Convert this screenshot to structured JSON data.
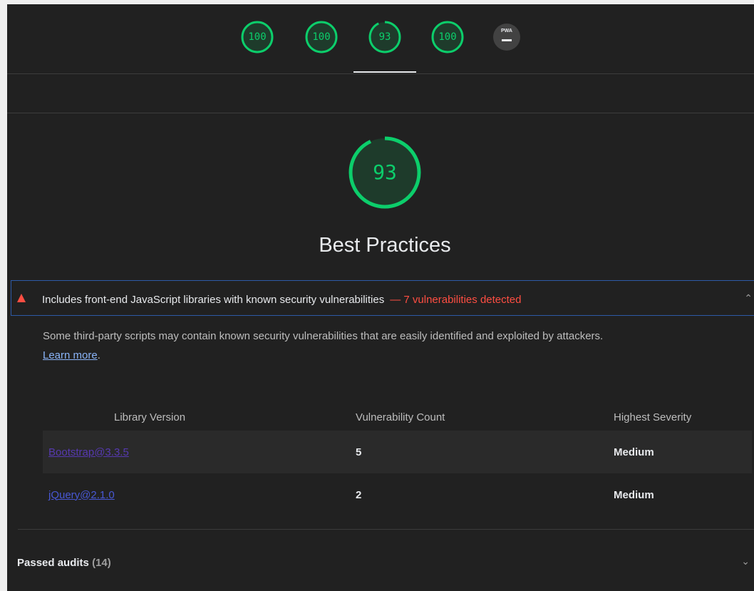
{
  "gauges": [
    {
      "score": "100",
      "value": 100
    },
    {
      "score": "100",
      "value": 100
    },
    {
      "score": "93",
      "value": 93
    },
    {
      "score": "100",
      "value": 100
    }
  ],
  "pwa": {
    "label": "PWA"
  },
  "category": {
    "score": "93",
    "value": 93,
    "title": "Best Practices"
  },
  "audit": {
    "title": "Includes front-end JavaScript libraries with known security vulnerabilities",
    "display_value": "— 7 vulnerabilities detected",
    "description": "Some third-party scripts may contain known security vulnerabilities that are easily identified and exploited by attackers.",
    "learn_more": "Learn more",
    "learn_more_suffix": ".",
    "table": {
      "headers": [
        "Library Version",
        "Vulnerability Count",
        "Highest Severity"
      ],
      "rows": [
        {
          "library": "Bootstrap@3.3.5",
          "count": "5",
          "severity": "Medium"
        },
        {
          "library": "jQuery@2.1.0",
          "count": "2",
          "severity": "Medium"
        }
      ]
    }
  },
  "passed": {
    "label": "Passed audits",
    "count": "(14)"
  },
  "colors": {
    "pass": "#0cce6b",
    "fail": "#ff4e42",
    "background": "#212121"
  }
}
